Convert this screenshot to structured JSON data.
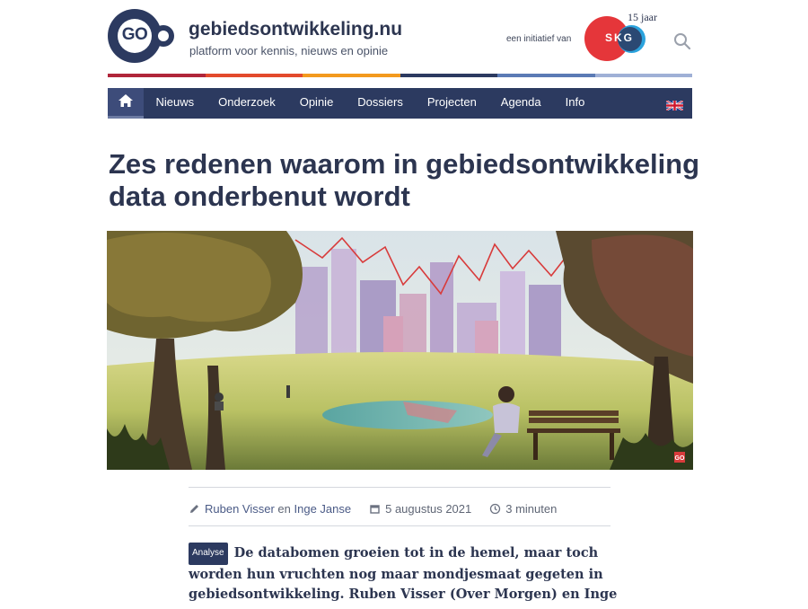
{
  "site": {
    "logo_text": "GO",
    "title": "gebiedsontwikkeling.nu",
    "tagline": "platform voor kennis, nieuws en opinie",
    "initiative_label": "een initiatief van",
    "partner_logo_text": "SKG",
    "anniversary": "15 jaar",
    "search_icon": "search-icon"
  },
  "colors": {
    "navy": "#2c3a60",
    "red": "#e5363a",
    "blue": "#2ba3dd",
    "stripe": [
      "#b0253a",
      "#e34a2c",
      "#f39a1e",
      "#2c3a60",
      "#5b7bb5",
      "#9fb0d6"
    ]
  },
  "nav": {
    "home_icon": "home-icon",
    "items": [
      "Nieuws",
      "Onderzoek",
      "Opinie",
      "Dossiers",
      "Projecten",
      "Agenda",
      "Info"
    ],
    "language_icon": "uk-flag-icon"
  },
  "article": {
    "title": "Zes redenen waarom in gebiedsontwikkeling data onderbenut wordt",
    "image_signature": "GO",
    "authors_prefix_link": "Ruben Visser",
    "authors_joiner": " en ",
    "authors_second_link": "Inge Janse",
    "date": "5 augustus 2021",
    "reading_time": "3 minuten",
    "category": "Analyse",
    "intro": "De databomen groeien tot in de hemel, maar toch worden hun vruchten nog maar mondjesmaat gegeten in gebiedsontwikkeling. Ruben Visser (Over Morgen) en Inge Janse"
  }
}
